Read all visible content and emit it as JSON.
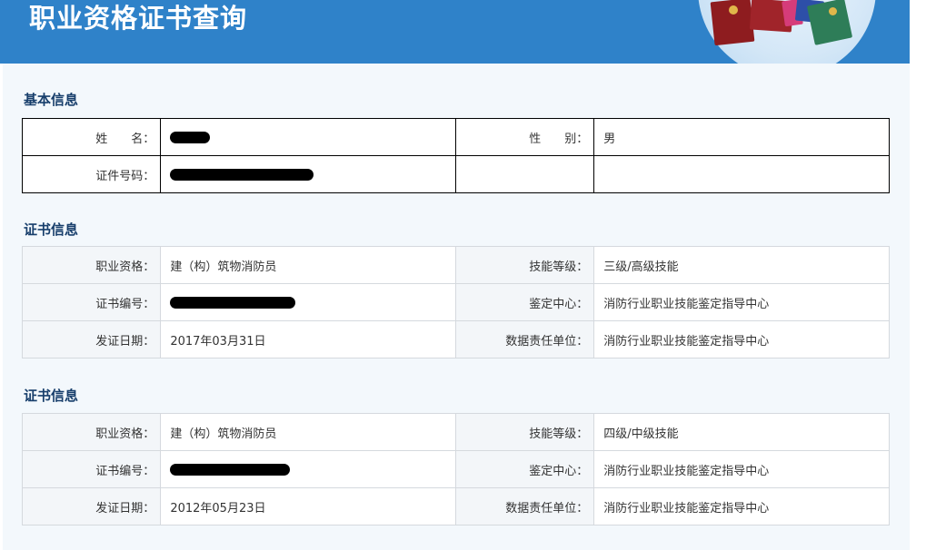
{
  "header": {
    "title": "职业资格证书查询"
  },
  "basic": {
    "title": "基本信息",
    "name_label": "姓　　名：",
    "gender_label": "性　　别：",
    "gender_value": "男",
    "id_label": "证件号码："
  },
  "certificates": [
    {
      "title": "证书信息",
      "qualification_label": "职业资格：",
      "qualification_value": "建（构）筑物消防员",
      "level_label": "技能等级：",
      "level_value": "三级/高级技能",
      "number_label": "证书编号：",
      "center_label": "鉴定中心：",
      "center_value": "消防行业职业技能鉴定指导中心",
      "date_label": "发证日期：",
      "date_value": "2017年03月31日",
      "unit_label": "数据责任单位：",
      "unit_value": "消防行业职业技能鉴定指导中心"
    },
    {
      "title": "证书信息",
      "qualification_label": "职业资格：",
      "qualification_value": "建（构）筑物消防员",
      "level_label": "技能等级：",
      "level_value": "四级/中级技能",
      "number_label": "证书编号：",
      "center_label": "鉴定中心：",
      "center_value": "消防行业职业技能鉴定指导中心",
      "date_label": "发证日期：",
      "date_value": "2012年05月23日",
      "unit_label": "数据责任单位：",
      "unit_value": "消防行业职业技能鉴定指导中心"
    }
  ]
}
